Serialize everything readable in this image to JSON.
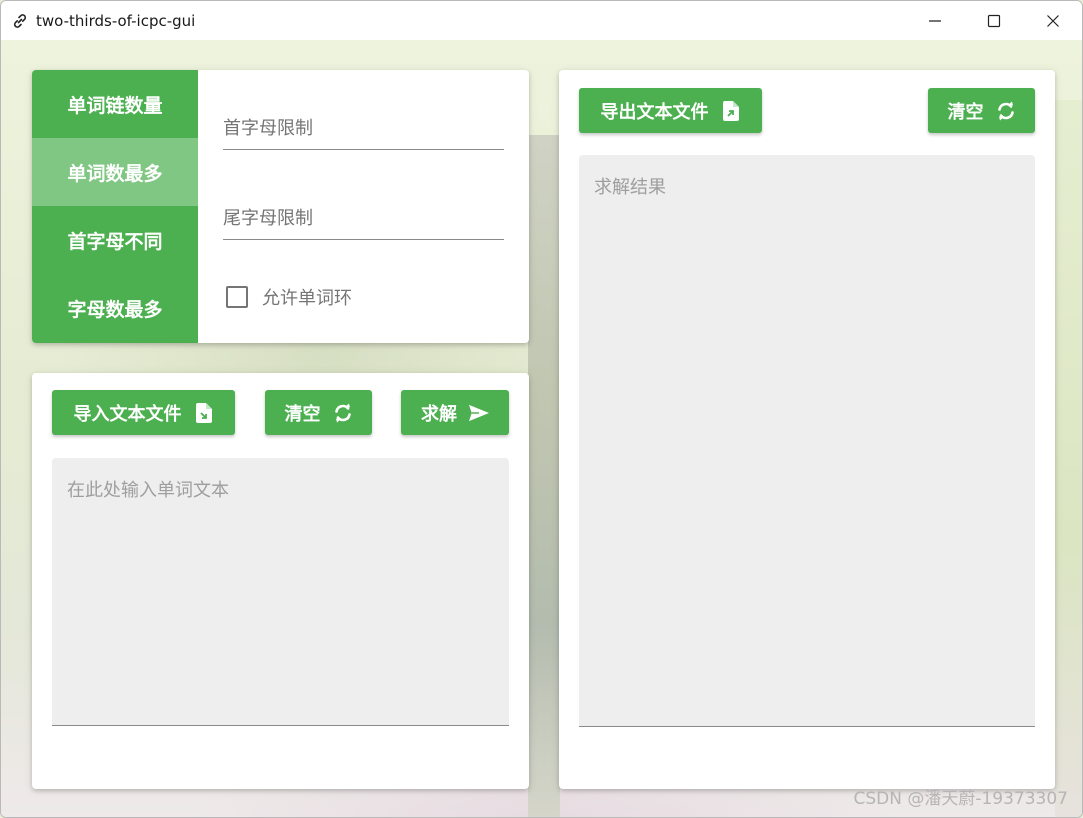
{
  "window": {
    "title": "two-thirds-of-icpc-gui"
  },
  "modes": [
    {
      "label": "单词链数量",
      "active": false
    },
    {
      "label": "单词数最多",
      "active": true
    },
    {
      "label": "首字母不同",
      "active": false
    },
    {
      "label": "字母数最多",
      "active": false
    }
  ],
  "options": {
    "head_placeholder": "首字母限制",
    "tail_placeholder": "尾字母限制",
    "allow_cycle_label": "允许单词环",
    "allow_cycle_checked": false
  },
  "input_panel": {
    "import_label": "导入文本文件",
    "clear_label": "清空",
    "solve_label": "求解",
    "placeholder": "在此处输入单词文本"
  },
  "output_panel": {
    "export_label": "导出文本文件",
    "clear_label": "清空",
    "placeholder": "求解结果"
  },
  "watermark": "CSDN @潘天蔚-19373307",
  "colors": {
    "primary": "#4caf50",
    "tab_active": "#81c784",
    "field_bg": "#eeeeee"
  },
  "icons": [
    "link-icon",
    "minimize-icon",
    "maximize-icon",
    "close-icon",
    "file-import-icon",
    "refresh-icon",
    "send-icon",
    "file-export-icon"
  ]
}
